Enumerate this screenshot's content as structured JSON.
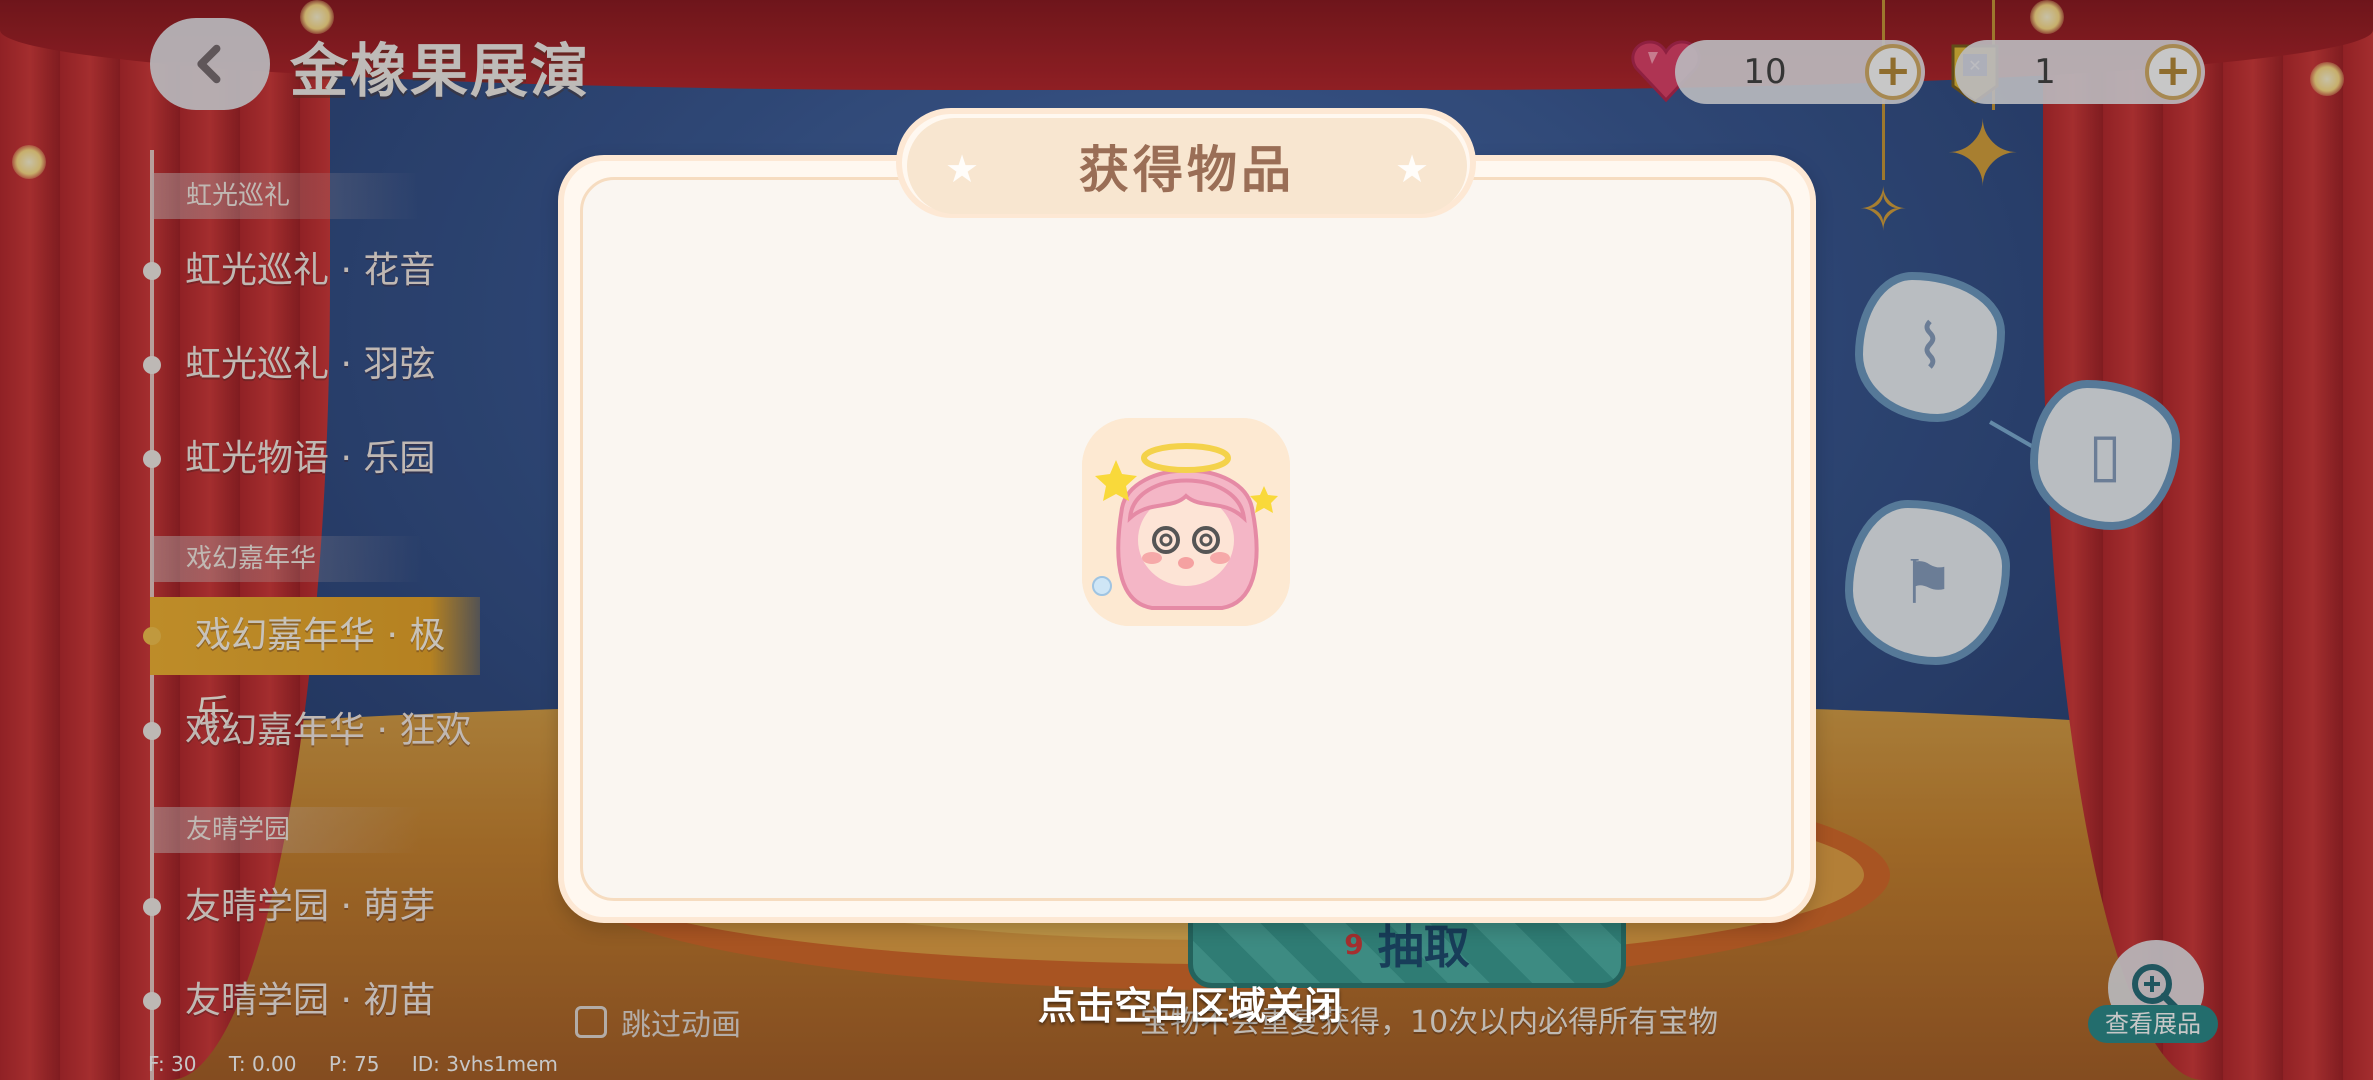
{
  "header": {
    "title": "金橡果展演",
    "back_icon": "back-arrow-icon",
    "currencies": [
      {
        "icon": "heart-gem-icon",
        "value": "10",
        "color": "#e0436b"
      },
      {
        "icon": "ticket-icon",
        "value": "1",
        "color": "#e8c13c"
      }
    ]
  },
  "sidebar": {
    "groups": [
      {
        "label": "虹光巡礼",
        "items": [
          "虹光巡礼 · 花音",
          "虹光巡礼 · 羽弦",
          "虹光物语 · 乐园"
        ]
      },
      {
        "label": "戏幻嘉年华",
        "items": [
          "戏幻嘉年华 · 极乐",
          "戏幻嘉年华 · 狂欢"
        ]
      },
      {
        "label": "友晴学园",
        "items": [
          "友晴学园 · 萌芽",
          "友晴学园 · 初苗"
        ]
      }
    ],
    "active_item": "戏幻嘉年华 · 极乐"
  },
  "bottom": {
    "skip_animation": "跳过动画",
    "draw_button": "抽取",
    "draw_count": "9",
    "guarantee_text": "宝物不会重复获得，10次以内必得所有宝物",
    "view_exhibit": "查看展品"
  },
  "modal": {
    "title": "获得物品",
    "reward_icon": "pink-hair-chibi-avatar-icon",
    "close_hint": "点击空白区域关闭"
  },
  "debug": {
    "f": "F: 30",
    "t": "T: 0.00",
    "p": "P: 75",
    "id": "ID: 3vhs1mem"
  },
  "colors": {
    "accent_gold": "#f3b435",
    "modal_bg": "#faf6f1",
    "title_text": "#9a6e56"
  }
}
